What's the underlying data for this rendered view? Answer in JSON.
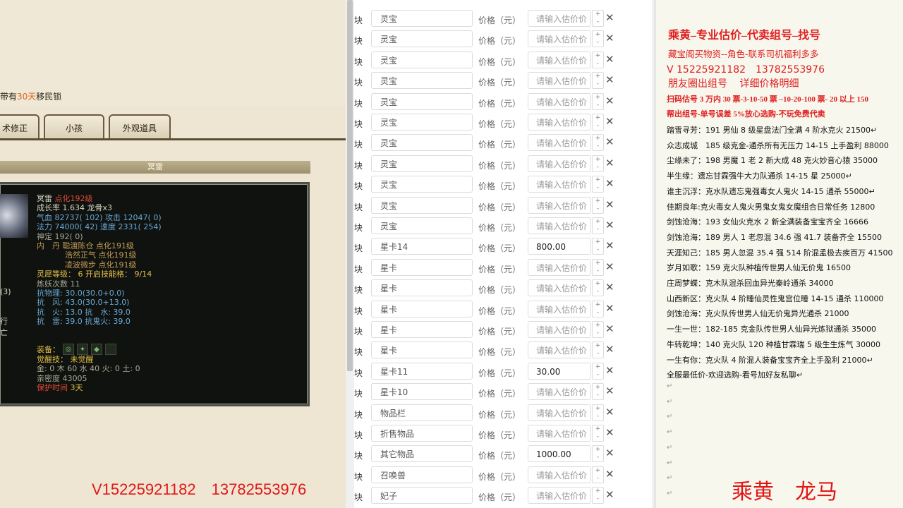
{
  "game": {
    "notice": {
      "prefix": "带有",
      "highlight": "30天",
      "suffix": "移民锁"
    },
    "tabs": [
      "术修正",
      "小孩",
      "外观道具"
    ],
    "bar_title": "冥雷",
    "stats": {
      "name": "冥雷",
      "level": "点化192级",
      "growth": "成长率 1.634 龙骨x3",
      "hp": "气血 82737( 102) 攻击 12047( 0)",
      "mp": "法力 74000( 42) 速度 2331( 254)",
      "shen": "神定 192( 0)",
      "inner1": "内　丹 聪渡陈仓 点化191级",
      "inner2": "浩然正气 点化191级",
      "inner3": "凌波微步 点化191级",
      "spirit": "灵犀等级： 6 开启技能格： 9/14",
      "refine": "炼妖次数 11",
      "res1": "抗物理: 30.0(30.0+0.0)",
      "res2": "抗　风: 43.0(30.0+13.0)",
      "res3": "抗　火: 13.0 抗　水: 39.0",
      "res4": "抗　雷: 39.0 抗鬼火: 39.0",
      "equip_label": "装备：",
      "awaken": "觉醒技： 未觉醒",
      "elements": "金: 0 木 60 水 40 火: 0 土: 0",
      "affinity": "亲密度 43005",
      "protect_label": "保护时间",
      "protect_value": "3天"
    },
    "left_frags": [
      "(3)",
      "行",
      "亡"
    ],
    "contact": "V15225921182　13782553976"
  },
  "form": {
    "rows": [
      {
        "kuai": "块",
        "name": "灵宝",
        "label": "价格（元）",
        "value": "",
        "placeholder": "请输入估价价"
      },
      {
        "kuai": "块",
        "name": "灵宝",
        "label": "价格（元）",
        "value": "",
        "placeholder": "请输入估价价"
      },
      {
        "kuai": "块",
        "name": "灵宝",
        "label": "价格（元）",
        "value": "",
        "placeholder": "请输入估价价"
      },
      {
        "kuai": "块",
        "name": "灵宝",
        "label": "价格（元）",
        "value": "",
        "placeholder": "请输入估价价"
      },
      {
        "kuai": "块",
        "name": "灵宝",
        "label": "价格（元）",
        "value": "",
        "placeholder": "请输入估价价"
      },
      {
        "kuai": "块",
        "name": "灵宝",
        "label": "价格（元）",
        "value": "",
        "placeholder": "请输入估价价"
      },
      {
        "kuai": "块",
        "name": "灵宝",
        "label": "价格（元）",
        "value": "",
        "placeholder": "请输入估价价"
      },
      {
        "kuai": "块",
        "name": "灵宝",
        "label": "价格（元）",
        "value": "",
        "placeholder": "请输入估价价"
      },
      {
        "kuai": "块",
        "name": "灵宝",
        "label": "价格（元）",
        "value": "",
        "placeholder": "请输入估价价"
      },
      {
        "kuai": "块",
        "name": "灵宝",
        "label": "价格（元）",
        "value": "",
        "placeholder": "请输入估价价"
      },
      {
        "kuai": "块",
        "name": "灵宝",
        "label": "价格（元）",
        "value": "",
        "placeholder": "请输入估价价"
      },
      {
        "kuai": "块",
        "name": "星卡14",
        "label": "价格（元）",
        "value": "800.00",
        "placeholder": "请输入估价价"
      },
      {
        "kuai": "块",
        "name": "星卡",
        "label": "价格（元）",
        "value": "",
        "placeholder": "请输入估价价"
      },
      {
        "kuai": "块",
        "name": "星卡",
        "label": "价格（元）",
        "value": "",
        "placeholder": "请输入估价价"
      },
      {
        "kuai": "块",
        "name": "星卡",
        "label": "价格（元）",
        "value": "",
        "placeholder": "请输入估价价"
      },
      {
        "kuai": "块",
        "name": "星卡",
        "label": "价格（元）",
        "value": "",
        "placeholder": "请输入估价价"
      },
      {
        "kuai": "块",
        "name": "星卡",
        "label": "价格（元）",
        "value": "",
        "placeholder": "请输入估价价"
      },
      {
        "kuai": "块",
        "name": "星卡11",
        "label": "价格（元）",
        "value": "30.00",
        "placeholder": "请输入估价价"
      },
      {
        "kuai": "块",
        "name": "星卡10",
        "label": "价格（元）",
        "value": "",
        "placeholder": "请输入估价价"
      },
      {
        "kuai": "块",
        "name": "物品栏",
        "label": "价格（元）",
        "value": "",
        "placeholder": "请输入估价价"
      },
      {
        "kuai": "块",
        "name": "折售物品",
        "label": "价格（元）",
        "value": "",
        "placeholder": "请输入估价价"
      },
      {
        "kuai": "块",
        "name": "其它物品",
        "label": "价格（元）",
        "value": "1000.00",
        "placeholder": "请输入估价价"
      },
      {
        "kuai": "块",
        "name": "召唤兽",
        "label": "价格（元）",
        "value": "",
        "placeholder": "请输入估价价"
      },
      {
        "kuai": "块",
        "name": "妃子",
        "label": "价格（元）",
        "value": "",
        "placeholder": "请输入估价价"
      }
    ],
    "plus": "+",
    "minus": "-",
    "close": "✕"
  },
  "ad": {
    "brand": "乘黄–专业估价–代卖组号–找号",
    "sub1": "藏宝阁买物资--角色-联系司机福利多多",
    "phone": "V 15225921182　13782553976",
    "circle": "朋友圈出组号　 详细价格明细",
    "bold1": "扫码估号 3 万内 30 票-3-10-50 票 –10-20-100 票- 20 以上 150",
    "bold2": "帮出组号-单号误差 5%放心选购-不玩免费代卖",
    "list": [
      "踏雪寻芳：191 男仙 8 级星盘法门全满 4 阶水克火 21500↵",
      "众志成城　185 级克金-通杀所有无压力 14-15 上手盈利 88000",
      "尘缘未了：198 男魔 1 老 2 新大成 48 克火妙音心猿 35000",
      "半生缘：遗忘甘霖强牛大力队通杀 14-15 星 25000↵",
      "谁主沉浮：克水队遗忘鬼强毒女人鬼火 14-15 通杀 55000↵",
      "佳期良年:克火毒女人鬼火男鬼女鬼女魔组合日常任务 12800",
      "剑蚀沧海：193 女仙火克水 2 新全满装备宝宝齐全 16666",
      "剑蚀沧海：189 男人 1 老忽混 34.6 强 41.7 装备齐全 15500",
      "天涯知己：185 男人忽混 35.4 强 514 阶混孟极去疾百万 41500",
      "岁月如歌：159 克火队种植传世男人仙无价鬼 16500",
      "庄周梦蝶：克木队混杀回血异光秦岭通杀 34000",
      "山西新区：克火队 4 阶睡仙灵性鬼宫位睡 14-15 通杀 110000",
      "剑蚀沧海：克火队传世男人仙无价鬼异光通杀 21000",
      "一生一世：182-185 克金队传世男人仙异光炼狱通杀 35000",
      "牛转乾坤：140 克火队 120 种植甘霖瑞 5 级生生炼气 30000",
      "一生有你：克火队 4 阶混人装备宝宝齐全上手盈利 21000↵",
      "全服最低价-欢迎选购-看号加好友私聊↵"
    ],
    "return_mark": "↵",
    "contact": "乘黄　龙马"
  }
}
